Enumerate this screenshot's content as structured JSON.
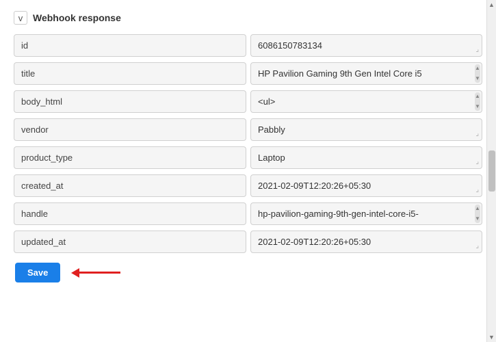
{
  "section": {
    "title": "Webhook response",
    "chevron_label": "v"
  },
  "fields": [
    {
      "label": "id",
      "value": "6086150783134",
      "has_scroll": false,
      "has_resize": true
    },
    {
      "label": "title",
      "value": "HP Pavilion Gaming 9th Gen Intel Core i5",
      "has_scroll": true,
      "has_resize": true
    },
    {
      "label": "body_html",
      "value": "<ul>",
      "has_scroll": true,
      "has_resize": true
    },
    {
      "label": "vendor",
      "value": "Pabbly",
      "has_scroll": false,
      "has_resize": true
    },
    {
      "label": "product_type",
      "value": "Laptop",
      "has_scroll": false,
      "has_resize": true
    },
    {
      "label": "created_at",
      "value": "2021-02-09T12:20:26+05:30",
      "has_scroll": false,
      "has_resize": true
    },
    {
      "label": "handle",
      "value": "hp-pavilion-gaming-9th-gen-intel-core-i5-",
      "has_scroll": true,
      "has_resize": true
    },
    {
      "label": "updated_at",
      "value": "2021-02-09T12:20:26+05:30",
      "has_scroll": false,
      "has_resize": true
    }
  ],
  "footer": {
    "save_label": "Save"
  }
}
